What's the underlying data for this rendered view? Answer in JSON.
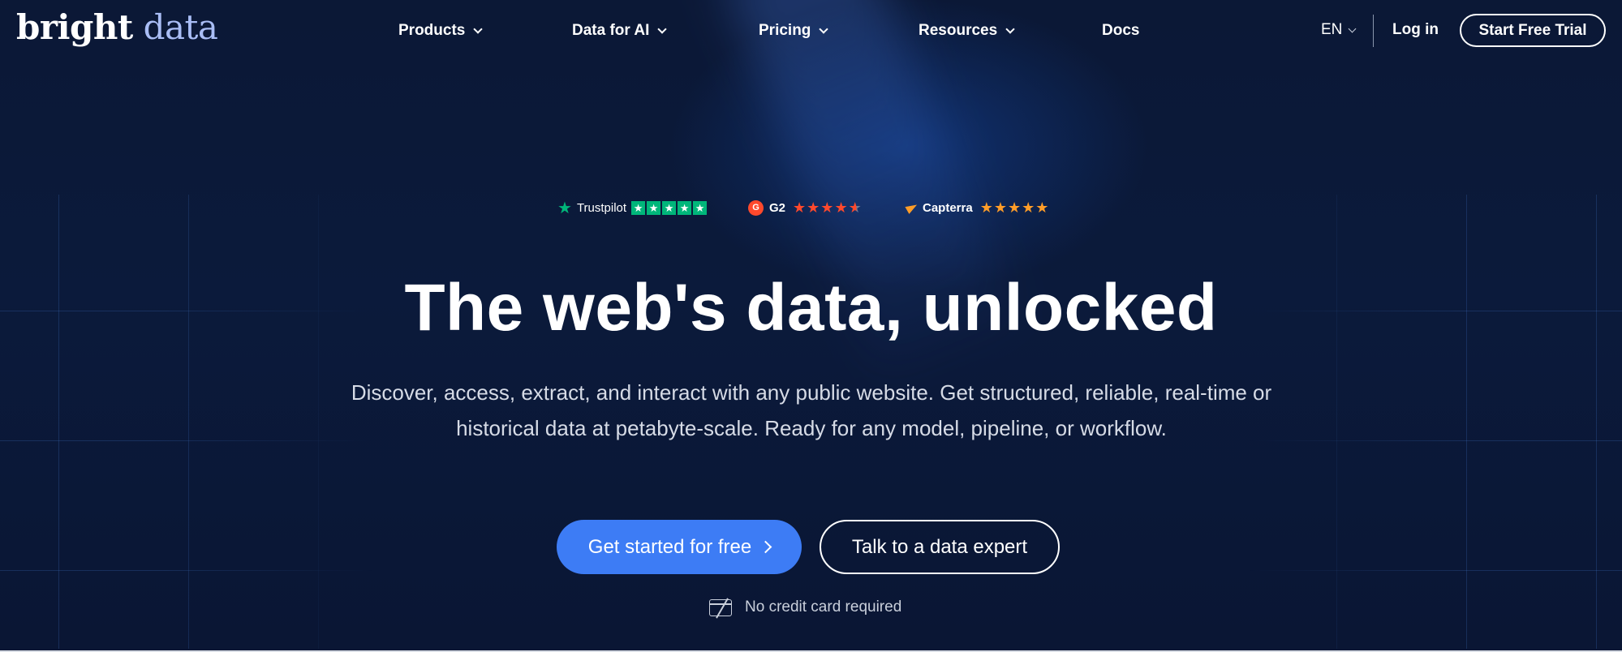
{
  "logo": {
    "word1": "bright",
    "word2": "data"
  },
  "nav": {
    "items": [
      {
        "label": "Products",
        "has_dropdown": true
      },
      {
        "label": "Data for AI",
        "has_dropdown": true
      },
      {
        "label": "Pricing",
        "has_dropdown": true
      },
      {
        "label": "Resources",
        "has_dropdown": true
      },
      {
        "label": "Docs",
        "has_dropdown": false
      }
    ],
    "language": "EN",
    "login_label": "Log in",
    "trial_label": "Start Free Trial"
  },
  "ratings": [
    {
      "name": "Trustpilot",
      "icon": "trustpilot-star-icon",
      "stars": 5,
      "color": "#00b67a"
    },
    {
      "name": "G2",
      "icon": "g2-logo-icon",
      "stars": 4.5,
      "color": "#ff492c"
    },
    {
      "name": "Capterra",
      "icon": "capterra-logo-icon",
      "stars": 5,
      "color": "#ff9d28"
    }
  ],
  "hero": {
    "headline": "The web's data, unlocked",
    "subtext": "Discover, access, extract, and interact with any public website. Get structured, reliable, real-time or historical data at petabyte-scale. Ready for any model, pipeline, or workflow.",
    "primary_cta": "Get started for free",
    "secondary_cta": "Talk to a data expert",
    "note": "No credit card required"
  },
  "colors": {
    "background": "#0a1633",
    "accent": "#3d7cf5",
    "logo_secondary": "#a9bdf5"
  }
}
